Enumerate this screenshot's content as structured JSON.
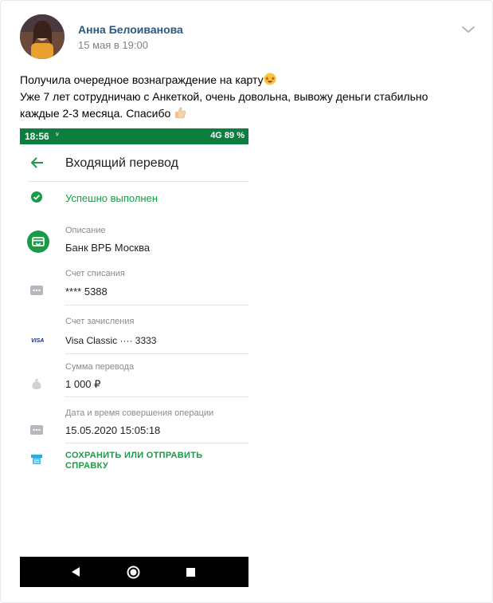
{
  "post": {
    "author_name": "Анна Белоиванова",
    "date": "15 мая в 19:00",
    "text_line_1": "Получила очередное вознаграждение на карту",
    "text_line_2": "Уже 7 лет сотрудничаю с Анкеткой, очень довольна, вывожу деньги стабильно",
    "text_line_3": "каждые 2-3 месяца. Спасибо",
    "icons": {
      "menu": "chevron-down-icon",
      "emoji_1": "star-struck-emoji",
      "emoji_2": "thumbs-up-emoji"
    }
  },
  "screenshot": {
    "status_bar": {
      "time": "18:56",
      "right_text": "4G 89 %",
      "color": "#0c7f3f"
    },
    "title": "Входящий перевод",
    "status_text": "Успешно выполнен",
    "fields": [
      {
        "label": "Описание",
        "value": "Банк ВРБ Москва",
        "icon": "bank-card-icon"
      },
      {
        "label": "Счет списания",
        "value": "**** 5388",
        "icon": "card-icon"
      },
      {
        "label": "Счет зачисления",
        "value": "Visa Classic ···· 3333",
        "icon": "visa-icon",
        "icon_text": "VISA"
      },
      {
        "label": "Сумма перевода",
        "value": "1 000 ₽",
        "icon": "money-bag-icon"
      },
      {
        "label": "Дата и время совершения операции",
        "value": "15.05.2020 15:05:18",
        "icon": "card-icon"
      }
    ],
    "action_line_1": "СОХРАНИТЬ ИЛИ ОТПРАВИТЬ",
    "action_line_2": "СПРАВКУ",
    "accent_color": "#1a9b47"
  }
}
